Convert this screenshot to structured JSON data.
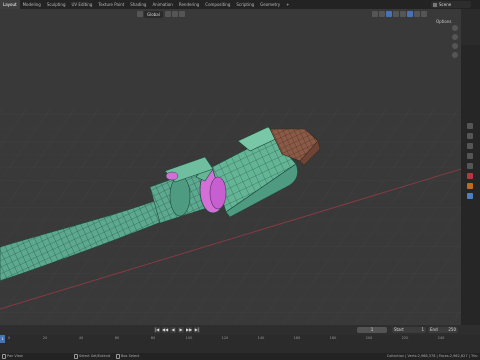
{
  "workspace_tabs": [
    "Layout",
    "Modeling",
    "Sculpting",
    "UV Editing",
    "Texture Paint",
    "Shading",
    "Animation",
    "Rendering",
    "Compositing",
    "Scripting",
    "Geometry"
  ],
  "active_tab_index": 0,
  "add_tab_symbol": "+",
  "scene_name": "Scene",
  "viewport": {
    "orientation_label": "Global",
    "options_label": "Options"
  },
  "colors": {
    "viewport_bg": "#393939",
    "mesh_green": "#5ca98f",
    "wire": "#1d3a32",
    "inner_pink": "#d36fd6",
    "plug_copper": "#8a5a47",
    "x_axis": "#8c3a46"
  },
  "timeline": {
    "playback_buttons": [
      "|◀",
      "◀◀",
      "◀",
      "▶",
      "▶▶",
      "▶|"
    ],
    "current_frame": "1",
    "start_label": "Start",
    "start_value": "1",
    "end_label": "End",
    "end_value": "250",
    "ruler_ticks": [
      "0",
      "20",
      "40",
      "60",
      "80",
      "100",
      "120",
      "140",
      "160",
      "180",
      "200",
      "220",
      "240"
    ],
    "playhead_value": "1"
  },
  "statusbar": {
    "left_action": "Pan View",
    "mid_action": "Select Set/Extend",
    "right_action": "Box Select",
    "stats": "Collection | Verts:2,968,378 | Faces:2,962,827 | Tris:"
  }
}
